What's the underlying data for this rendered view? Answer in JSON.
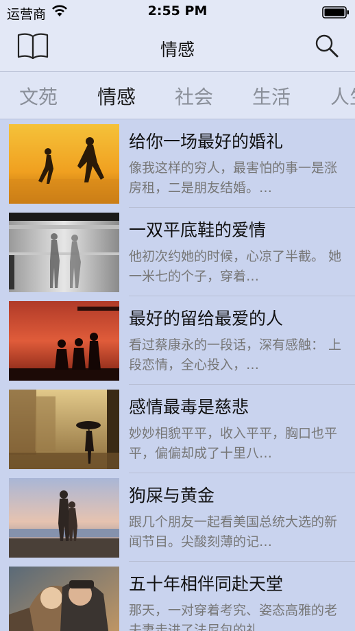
{
  "status_bar": {
    "carrier": "运营商",
    "time": "2:55 PM"
  },
  "nav": {
    "title": "情感",
    "left_icon": "book-icon",
    "right_icon": "search-icon"
  },
  "tabs": [
    {
      "label": "文苑",
      "active": false
    },
    {
      "label": "情感",
      "active": true
    },
    {
      "label": "社会",
      "active": false
    },
    {
      "label": "生活",
      "active": false
    },
    {
      "label": "人生",
      "active": false
    }
  ],
  "articles": [
    {
      "title": "给你一场最好的婚礼",
      "summary": "像我这样的穷人，最害怕的事一是涨房租，二是朋友结婚。…"
    },
    {
      "title": "一双平底鞋的爱情",
      "summary": "他初次约她的时候，心凉了半截。 她一米七的个子，穿着…"
    },
    {
      "title": "最好的留给最爱的人",
      "summary": "看过蔡康永的一段话，深有感触： 上段恋情，全心投入，…"
    },
    {
      "title": "感情最毒是慈悲",
      "summary": "妙妙相貌平平，收入平平，胸口也平平，偏偏却成了十里八…"
    },
    {
      "title": "狗屎与黄金",
      "summary": "跟几个朋友一起看美国总统大选的新闻节目。尖酸刻薄的记…"
    },
    {
      "title": "五十年相伴同赴天堂",
      "summary": "那天，一对穿着考究、姿态高雅的老夫妻走进了法尼包的礼…"
    }
  ]
}
